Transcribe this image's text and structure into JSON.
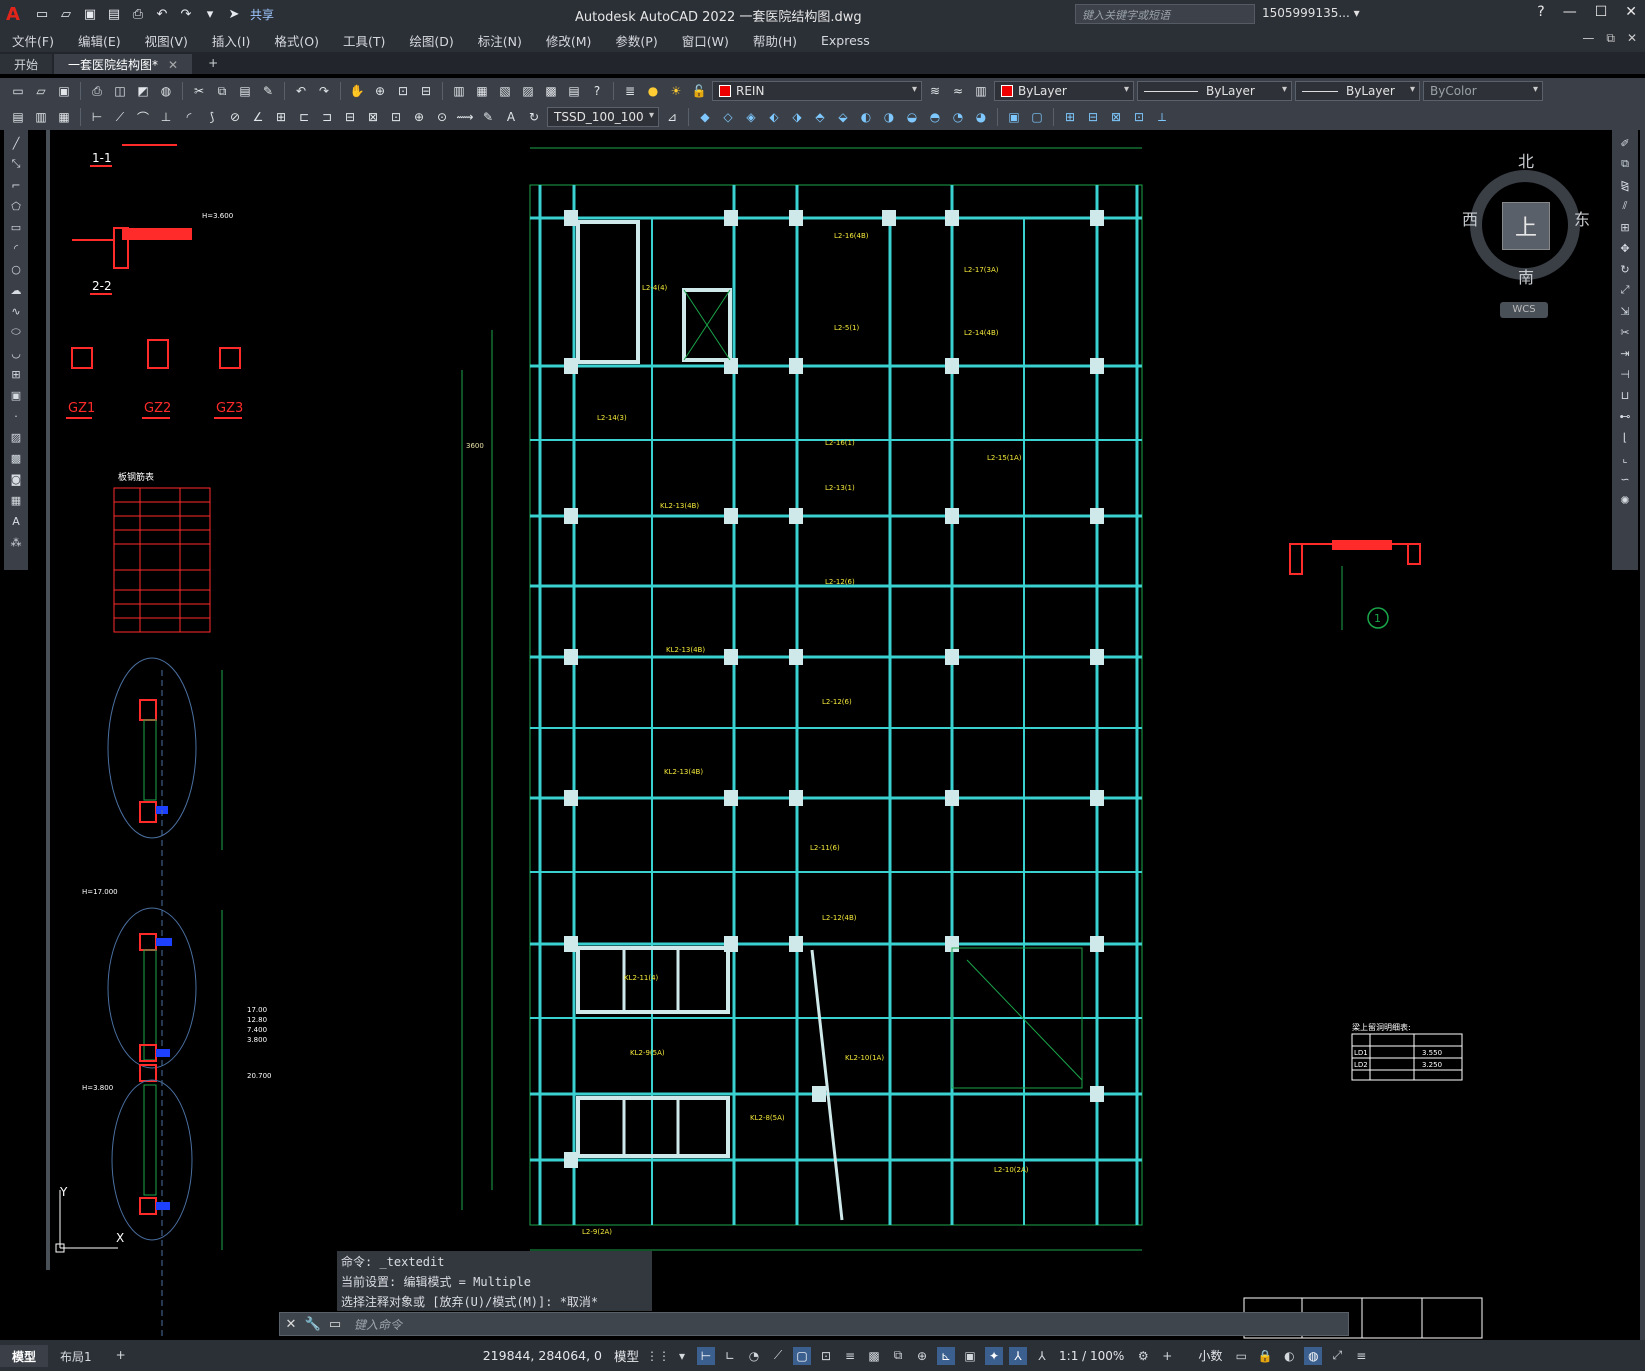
{
  "titlebar": {
    "app_title": "Autodesk AutoCAD 2022    一套医院结构图.dwg",
    "share": "共享",
    "search_placeholder": "键入关键字或短语",
    "user": "1505999135... ▾",
    "min": "—",
    "restore": "☐",
    "close": "✕"
  },
  "menu": {
    "items": [
      "文件(F)",
      "编辑(E)",
      "视图(V)",
      "插入(I)",
      "格式(O)",
      "工具(T)",
      "绘图(D)",
      "标注(N)",
      "修改(M)",
      "参数(P)",
      "窗口(W)",
      "帮助(H)",
      "Express"
    ]
  },
  "tabs": {
    "start": "开始",
    "doc": "一套医院结构图*",
    "close": "✕",
    "add": "+"
  },
  "toolbar": {
    "layer": "REIN",
    "color": "ByLayer",
    "linetype": "ByLayer",
    "lineweight": "ByLayer",
    "plotstyle": "ByColor",
    "dimstyle": "TSSD_100_100",
    "layer_color": "#e00000"
  },
  "viewcube": {
    "north": "北",
    "south": "南",
    "west": "西",
    "east": "东",
    "face": "上",
    "wcs": "WCS"
  },
  "drawing": {
    "sec11": "1-1",
    "sec22": "2-2",
    "gz1": "GZ1",
    "gz2": "GZ2",
    "gz3": "GZ3",
    "table_title": "板钢筋表",
    "circle_label": "1",
    "ld_title": "梁上留洞明细表:",
    "ld1": "LD1",
    "ld2": "LD2",
    "ld1_h": "3.550",
    "ld2_h": "3.250",
    "span_3600": "3600",
    "axis_y": "Y",
    "axis_x": "X",
    "h_elev_1": "H=3.600",
    "h_elev_2": "H=17.000",
    "h_elev_3": "H=3.800",
    "lvl1": "17.00",
    "lvl2": "12.80",
    "lvl3": "7.400",
    "lvl4": "3.800",
    "lvl5": "20.700",
    "beam_labels": [
      "L2-14(3)",
      "L2-16(1)",
      "L2-15(1A)",
      "L2-13(1)",
      "KL2-13(4B)",
      "L2-12(6)",
      "KL2-13(4B)",
      "L2-12(6)",
      "KL2-13(4B)",
      "L2-11(6)",
      "L2-12(4B)",
      "KL2-11(4)",
      "KL2-9(5A)",
      "KL2-10(1A)",
      "KL2-8(5A)",
      "L2-10(2A)",
      "L2-9(2A)",
      "L2-17(3A)",
      "L2-14(4B)",
      "L2-16(4B)",
      "L2-5(1)",
      "L2-4(4)"
    ]
  },
  "command": {
    "history": [
      "命令: _textedit",
      "当前设置: 编辑模式 = Multiple",
      "选择注释对象或 [放弃(U)/模式(M)]: *取消*"
    ],
    "placeholder": "键入命令"
  },
  "status": {
    "model_tab": "模型",
    "layout_tab": "布局1",
    "add": "+",
    "coords": "219844, 284064, 0",
    "mode": "模型",
    "scale": "1:1 / 100%",
    "units": "小数"
  }
}
